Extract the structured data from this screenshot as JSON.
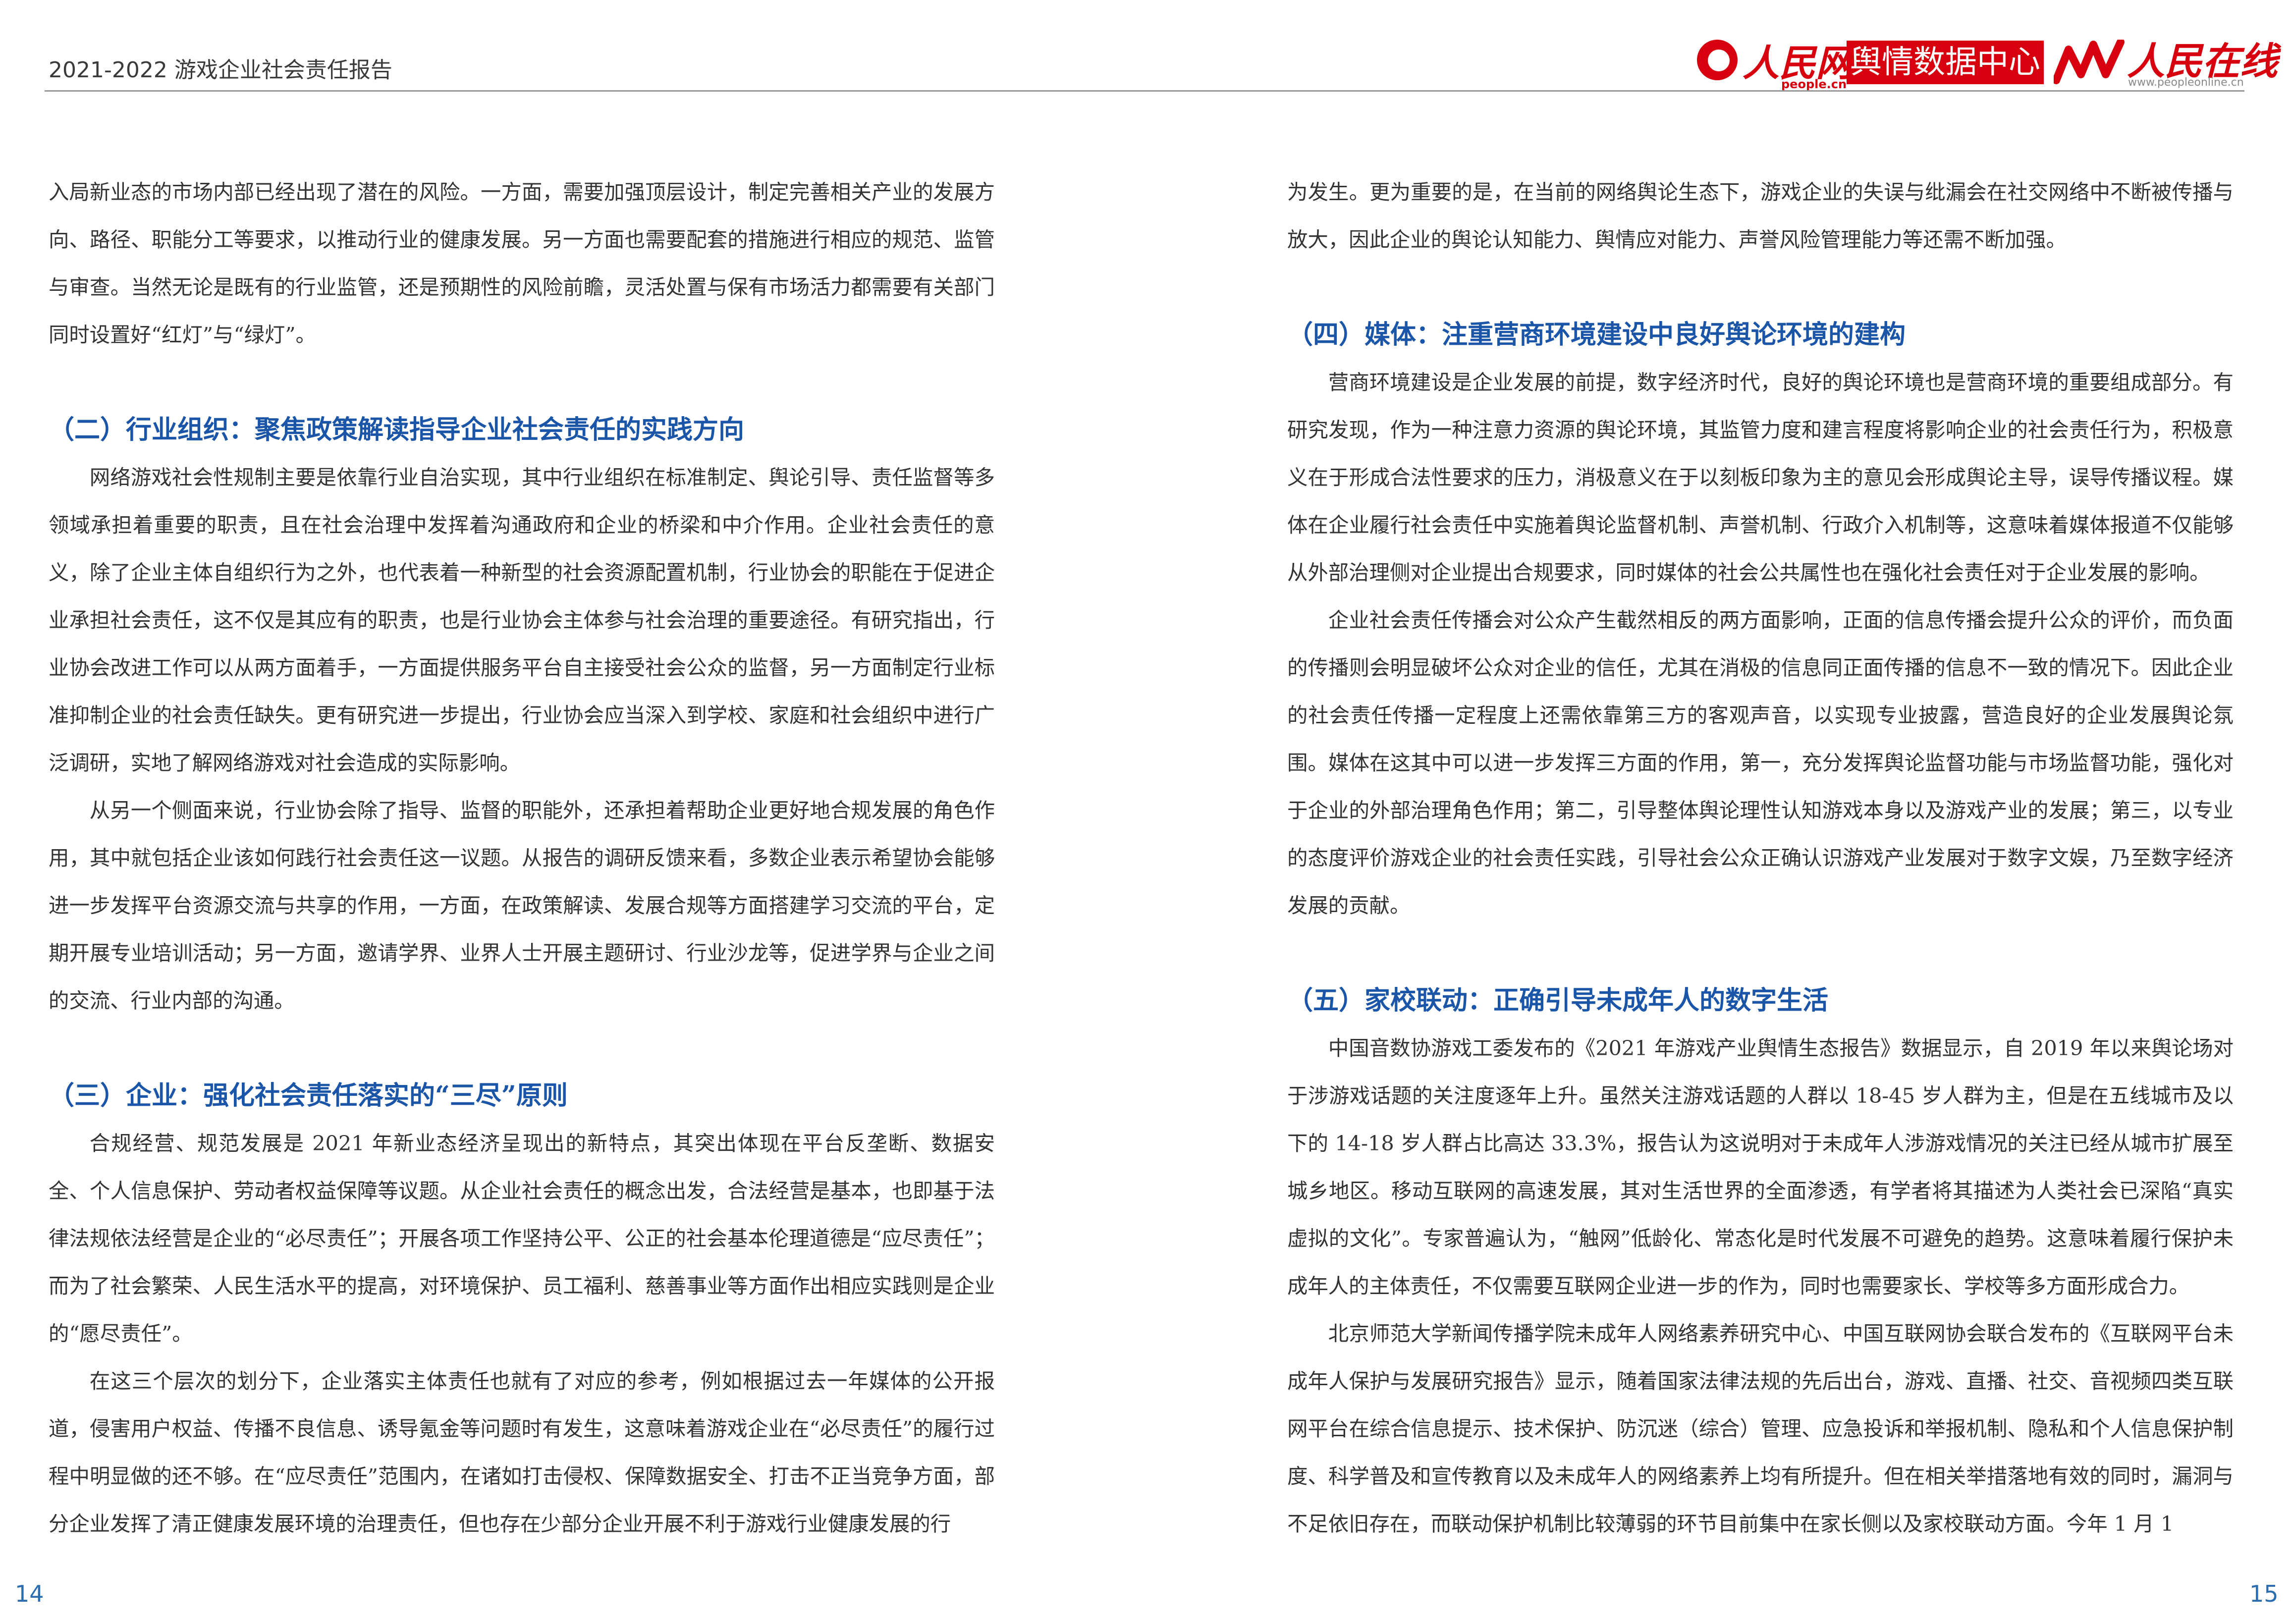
{
  "header": {
    "title": "2021-2022 游戏企业社会责任报告",
    "logos": {
      "people_daily": "人民网",
      "people_url": "people.cn",
      "data_center": "舆情数据中心",
      "people_online": "人民在线",
      "online_url": "www.peopleonline.cn"
    }
  },
  "left": {
    "p1": "入局新业态的市场内部已经出现了潜在的风险。一方面，需要加强顶层设计，制定完善相关产业的发展方向、路径、职能分工等要求，以推动行业的健康发展。另一方面也需要配套的措施进行相应的规范、监管与审查。当然无论是既有的行业监管，还是预期性的风险前瞻，灵活处置与保有市场活力都需要有关部门同时设置好“红灯”与“绿灯”。",
    "h2": "（二）行业组织：聚焦政策解读指导企业社会责任的实践方向",
    "p2": "网络游戏社会性规制主要是依靠行业自治实现，其中行业组织在标准制定、舆论引导、责任监督等多领域承担着重要的职责，且在社会治理中发挥着沟通政府和企业的桥梁和中介作用。企业社会责任的意义，除了企业主体自组织行为之外，也代表着一种新型的社会资源配置机制，行业协会的职能在于促进企业承担社会责任，这不仅是其应有的职责，也是行业协会主体参与社会治理的重要途径。有研究指出，行业协会改进工作可以从两方面着手，一方面提供服务平台自主接受社会公众的监督，另一方面制定行业标准抑制企业的社会责任缺失。更有研究进一步提出，行业协会应当深入到学校、家庭和社会组织中进行广泛调研，实地了解网络游戏对社会造成的实际影响。",
    "p3": "从另一个侧面来说，行业协会除了指导、监督的职能外，还承担着帮助企业更好地合规发展的角色作用，其中就包括企业该如何践行社会责任这一议题。从报告的调研反馈来看，多数企业表示希望协会能够进一步发挥平台资源交流与共享的作用，一方面，在政策解读、发展合规等方面搭建学习交流的平台，定期开展专业培训活动；另一方面，邀请学界、业界人士开展主题研讨、行业沙龙等，促进学界与企业之间的交流、行业内部的沟通。",
    "h3": "（三）企业：强化社会责任落实的“三尽”原则",
    "p4": "合规经营、规范发展是 2021 年新业态经济呈现出的新特点，其突出体现在平台反垄断、数据安全、个人信息保护、劳动者权益保障等议题。从企业社会责任的概念出发，合法经营是基本，也即基于法律法规依法经营是企业的“必尽责任”；开展各项工作坚持公平、公正的社会基本伦理道德是“应尽责任”；而为了社会繁荣、人民生活水平的提高，对环境保护、员工福利、慈善事业等方面作出相应实践则是企业的“愿尽责任”。",
    "p5": "在这三个层次的划分下，企业落实主体责任也就有了对应的参考，例如根据过去一年媒体的公开报道，侵害用户权益、传播不良信息、诱导氪金等问题时有发生，这意味着游戏企业在“必尽责任”的履行过程中明显做的还不够。在“应尽责任”范围内，在诸如打击侵权、保障数据安全、打击不正当竞争方面，部分企业发挥了清正健康发展环境的治理责任，但也存在少部分企业开展不利于游戏行业健康发展的行"
  },
  "right": {
    "p1": "为发生。更为重要的是，在当前的网络舆论生态下，游戏企业的失误与纰漏会在社交网络中不断被传播与放大，因此企业的舆论认知能力、舆情应对能力、声誉风险管理能力等还需不断加强。",
    "h4": "（四）媒体：注重营商环境建设中良好舆论环境的建构",
    "p2": "营商环境建设是企业发展的前提，数字经济时代，良好的舆论环境也是营商环境的重要组成部分。有研究发现，作为一种注意力资源的舆论环境，其监管力度和建言程度将影响企业的社会责任行为，积极意义在于形成合法性要求的压力，消极意义在于以刻板印象为主的意见会形成舆论主导，误导传播议程。媒体在企业履行社会责任中实施着舆论监督机制、声誉机制、行政介入机制等，这意味着媒体报道不仅能够从外部治理侧对企业提出合规要求，同时媒体的社会公共属性也在强化社会责任对于企业发展的影响。",
    "p3": "企业社会责任传播会对公众产生截然相反的两方面影响，正面的信息传播会提升公众的评价，而负面的传播则会明显破坏公众对企业的信任，尤其在消极的信息同正面传播的信息不一致的情况下。因此企业的社会责任传播一定程度上还需依靠第三方的客观声音，以实现专业披露，营造良好的企业发展舆论氛围。媒体在这其中可以进一步发挥三方面的作用，第一，充分发挥舆论监督功能与市场监督功能，强化对于企业的外部治理角色作用；第二，引导整体舆论理性认知游戏本身以及游戏产业的发展；第三，以专业的态度评价游戏企业的社会责任实践，引导社会公众正确认识游戏产业发展对于数字文娱，乃至数字经济发展的贡献。",
    "h5": "（五）家校联动：正确引导未成年人的数字生活",
    "p4": "中国音数协游戏工委发布的《2021 年游戏产业舆情生态报告》数据显示，自 2019 年以来舆论场对于涉游戏话题的关注度逐年上升。虽然关注游戏话题的人群以 18-45 岁人群为主，但是在五线城市及以下的 14-18 岁人群占比高达 33.3%，报告认为这说明对于未成年人涉游戏情况的关注已经从城市扩展至城乡地区。移动互联网的高速发展，其对生活世界的全面渗透，有学者将其描述为人类社会已深陷“真实虚拟的文化”。专家普遍认为，“触网”低龄化、常态化是时代发展不可避免的趋势。这意味着履行保护未成年人的主体责任，不仅需要互联网企业进一步的作为，同时也需要家长、学校等多方面形成合力。",
    "p5": "北京师范大学新闻传播学院未成年人网络素养研究中心、中国互联网协会联合发布的《互联网平台未成年人保护与发展研究报告》显示，随着国家法律法规的先后出台，游戏、直播、社交、音视频四类互联网平台在综合信息提示、技术保护、防沉迷（综合）管理、应急投诉和举报机制、隐私和个人信息保护制度、科学普及和宣传教育以及未成年人的网络素养上均有所提升。但在相关举措落地有效的同时，漏洞与不足依旧存在，而联动保护机制比较薄弱的环节目前集中在家长侧以及家校联动方面。今年 1 月 1"
  },
  "footer": {
    "page_left": "14",
    "page_right": "15"
  }
}
